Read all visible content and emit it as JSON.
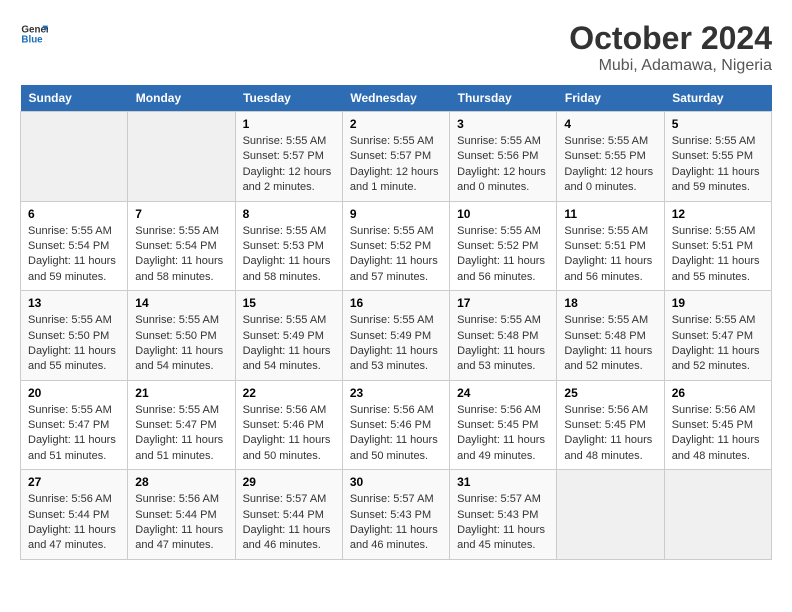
{
  "header": {
    "logo_general": "General",
    "logo_blue": "Blue",
    "title": "October 2024",
    "subtitle": "Mubi, Adamawa, Nigeria"
  },
  "columns": [
    "Sunday",
    "Monday",
    "Tuesday",
    "Wednesday",
    "Thursday",
    "Friday",
    "Saturday"
  ],
  "weeks": [
    [
      {
        "day": "",
        "info": ""
      },
      {
        "day": "",
        "info": ""
      },
      {
        "day": "1",
        "info": "Sunrise: 5:55 AM\nSunset: 5:57 PM\nDaylight: 12 hours and 2 minutes."
      },
      {
        "day": "2",
        "info": "Sunrise: 5:55 AM\nSunset: 5:57 PM\nDaylight: 12 hours and 1 minute."
      },
      {
        "day": "3",
        "info": "Sunrise: 5:55 AM\nSunset: 5:56 PM\nDaylight: 12 hours and 0 minutes."
      },
      {
        "day": "4",
        "info": "Sunrise: 5:55 AM\nSunset: 5:55 PM\nDaylight: 12 hours and 0 minutes."
      },
      {
        "day": "5",
        "info": "Sunrise: 5:55 AM\nSunset: 5:55 PM\nDaylight: 11 hours and 59 minutes."
      }
    ],
    [
      {
        "day": "6",
        "info": "Sunrise: 5:55 AM\nSunset: 5:54 PM\nDaylight: 11 hours and 59 minutes."
      },
      {
        "day": "7",
        "info": "Sunrise: 5:55 AM\nSunset: 5:54 PM\nDaylight: 11 hours and 58 minutes."
      },
      {
        "day": "8",
        "info": "Sunrise: 5:55 AM\nSunset: 5:53 PM\nDaylight: 11 hours and 58 minutes."
      },
      {
        "day": "9",
        "info": "Sunrise: 5:55 AM\nSunset: 5:52 PM\nDaylight: 11 hours and 57 minutes."
      },
      {
        "day": "10",
        "info": "Sunrise: 5:55 AM\nSunset: 5:52 PM\nDaylight: 11 hours and 56 minutes."
      },
      {
        "day": "11",
        "info": "Sunrise: 5:55 AM\nSunset: 5:51 PM\nDaylight: 11 hours and 56 minutes."
      },
      {
        "day": "12",
        "info": "Sunrise: 5:55 AM\nSunset: 5:51 PM\nDaylight: 11 hours and 55 minutes."
      }
    ],
    [
      {
        "day": "13",
        "info": "Sunrise: 5:55 AM\nSunset: 5:50 PM\nDaylight: 11 hours and 55 minutes."
      },
      {
        "day": "14",
        "info": "Sunrise: 5:55 AM\nSunset: 5:50 PM\nDaylight: 11 hours and 54 minutes."
      },
      {
        "day": "15",
        "info": "Sunrise: 5:55 AM\nSunset: 5:49 PM\nDaylight: 11 hours and 54 minutes."
      },
      {
        "day": "16",
        "info": "Sunrise: 5:55 AM\nSunset: 5:49 PM\nDaylight: 11 hours and 53 minutes."
      },
      {
        "day": "17",
        "info": "Sunrise: 5:55 AM\nSunset: 5:48 PM\nDaylight: 11 hours and 53 minutes."
      },
      {
        "day": "18",
        "info": "Sunrise: 5:55 AM\nSunset: 5:48 PM\nDaylight: 11 hours and 52 minutes."
      },
      {
        "day": "19",
        "info": "Sunrise: 5:55 AM\nSunset: 5:47 PM\nDaylight: 11 hours and 52 minutes."
      }
    ],
    [
      {
        "day": "20",
        "info": "Sunrise: 5:55 AM\nSunset: 5:47 PM\nDaylight: 11 hours and 51 minutes."
      },
      {
        "day": "21",
        "info": "Sunrise: 5:55 AM\nSunset: 5:47 PM\nDaylight: 11 hours and 51 minutes."
      },
      {
        "day": "22",
        "info": "Sunrise: 5:56 AM\nSunset: 5:46 PM\nDaylight: 11 hours and 50 minutes."
      },
      {
        "day": "23",
        "info": "Sunrise: 5:56 AM\nSunset: 5:46 PM\nDaylight: 11 hours and 50 minutes."
      },
      {
        "day": "24",
        "info": "Sunrise: 5:56 AM\nSunset: 5:45 PM\nDaylight: 11 hours and 49 minutes."
      },
      {
        "day": "25",
        "info": "Sunrise: 5:56 AM\nSunset: 5:45 PM\nDaylight: 11 hours and 48 minutes."
      },
      {
        "day": "26",
        "info": "Sunrise: 5:56 AM\nSunset: 5:45 PM\nDaylight: 11 hours and 48 minutes."
      }
    ],
    [
      {
        "day": "27",
        "info": "Sunrise: 5:56 AM\nSunset: 5:44 PM\nDaylight: 11 hours and 47 minutes."
      },
      {
        "day": "28",
        "info": "Sunrise: 5:56 AM\nSunset: 5:44 PM\nDaylight: 11 hours and 47 minutes."
      },
      {
        "day": "29",
        "info": "Sunrise: 5:57 AM\nSunset: 5:44 PM\nDaylight: 11 hours and 46 minutes."
      },
      {
        "day": "30",
        "info": "Sunrise: 5:57 AM\nSunset: 5:43 PM\nDaylight: 11 hours and 46 minutes."
      },
      {
        "day": "31",
        "info": "Sunrise: 5:57 AM\nSunset: 5:43 PM\nDaylight: 11 hours and 45 minutes."
      },
      {
        "day": "",
        "info": ""
      },
      {
        "day": "",
        "info": ""
      }
    ]
  ]
}
